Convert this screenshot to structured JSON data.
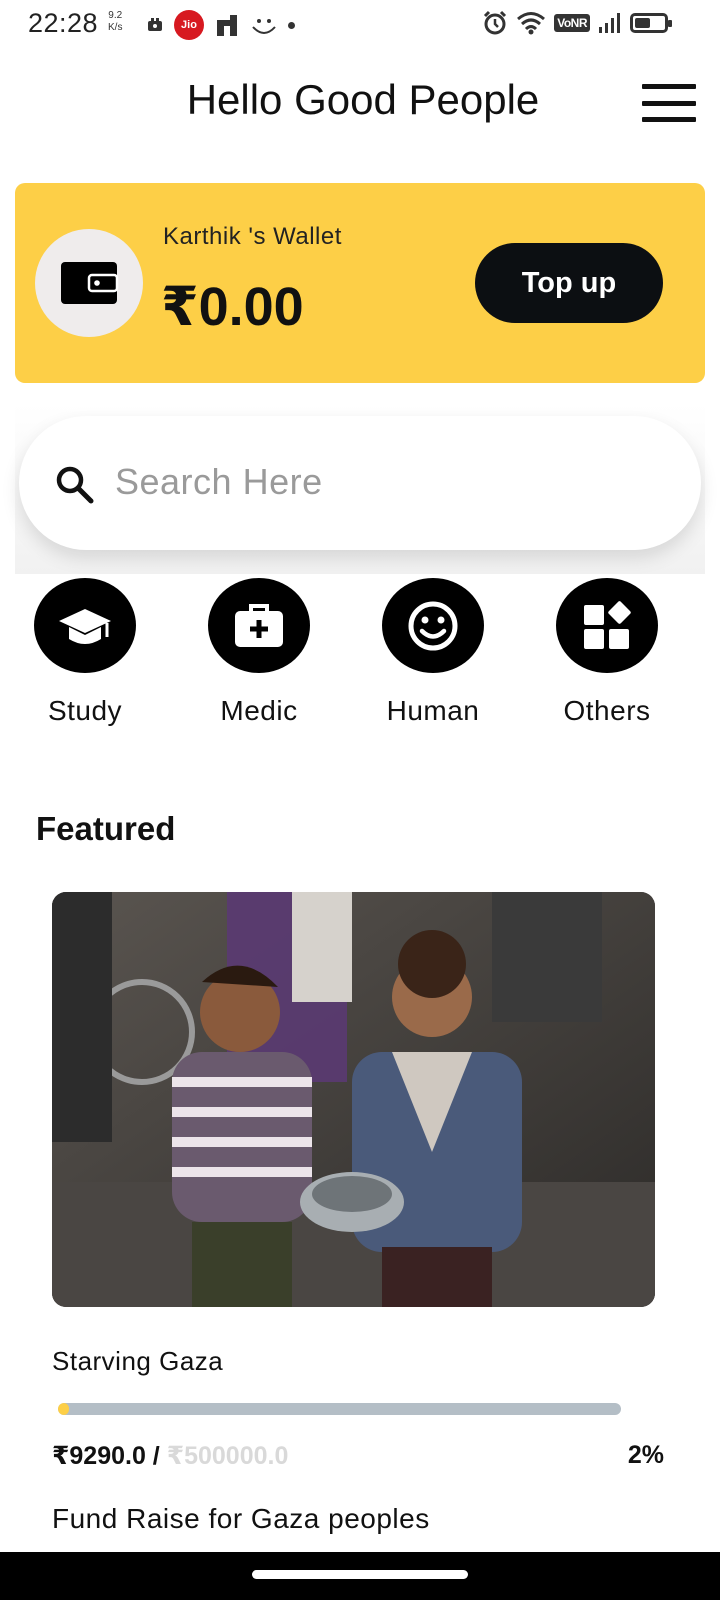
{
  "status_bar": {
    "time": "22:28",
    "speed_value": "9.2",
    "speed_unit": "K/s",
    "carrier": "Jio",
    "network_badge": "VoNR",
    "icons_left": [
      "video-icon",
      "jio-icon",
      "n-icon",
      "face-icon",
      "dot-icon"
    ],
    "icons_right": [
      "alarm-icon",
      "wifi-icon",
      "vonr-badge",
      "signal-icon",
      "battery-icon"
    ],
    "battery_level": 0.5
  },
  "header": {
    "title": "Hello Good People",
    "menu_icon": "hamburger-menu-icon"
  },
  "wallet": {
    "owner_label": "Karthik 's Wallet",
    "balance": "₹0.00",
    "topup_label": "Top up",
    "icon": "wallet-icon",
    "background_color": "#fdcf47"
  },
  "search": {
    "placeholder": "Search Here",
    "value": "",
    "icon": "search-icon"
  },
  "categories": [
    {
      "label": "Study",
      "icon": "graduation-cap-icon"
    },
    {
      "label": "Medic",
      "icon": "medical-kit-icon"
    },
    {
      "label": "Human",
      "icon": "smiley-face-icon"
    },
    {
      "label": "Others",
      "icon": "category-grid-icon"
    }
  ],
  "featured": {
    "section_title": "Featured",
    "campaign": {
      "image": "photo of children holding an empty bowl",
      "title": "Starving Gaza",
      "raised": "₹9290.0 / ",
      "goal": "₹500000.0",
      "percent_label": "2%",
      "progress_fraction": 0.02,
      "description": "Fund Raise for Gaza peoples"
    }
  },
  "colors": {
    "accent": "#fdcf47",
    "progress_track": "#b4bec6",
    "dark": "#0c0f12"
  }
}
